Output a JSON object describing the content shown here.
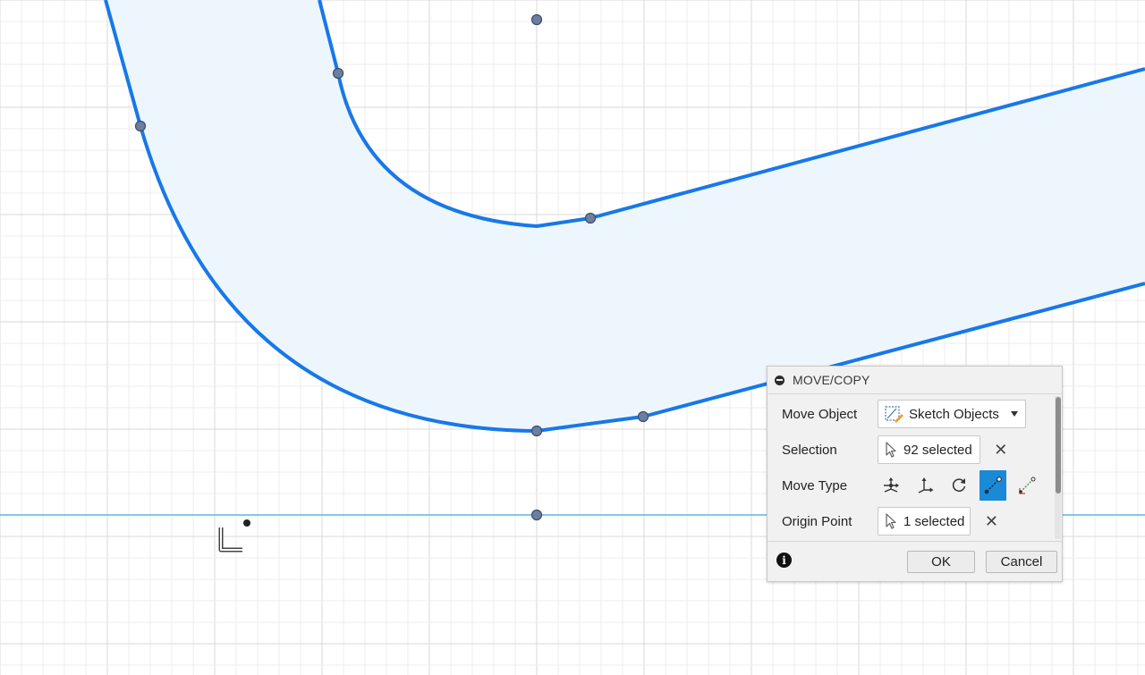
{
  "colors": {
    "curve": "#1878e8",
    "fill": "#eef6fd",
    "grid_minor": "#ececec",
    "grid_major": "#d8d8d8",
    "axis_line": "#5fb4ea",
    "point": "#6d7fa0",
    "active_tool": "#1a8ad6"
  },
  "canvas": {
    "sketch_points": 8,
    "origin_icon": "sketch-origin-icon"
  },
  "dialog": {
    "title": "MOVE/COPY",
    "move_object": {
      "label": "Move Object",
      "value": "Sketch Objects",
      "icon": "sketch-objects-icon"
    },
    "selection": {
      "label": "Selection",
      "value": "92 selected"
    },
    "move_type": {
      "label": "Move Type",
      "tools": [
        {
          "name": "free-move",
          "icon": "free-move-icon",
          "active": false
        },
        {
          "name": "translate",
          "icon": "translate-icon",
          "active": false
        },
        {
          "name": "rotate",
          "icon": "rotate-icon",
          "active": false
        },
        {
          "name": "point-to-point",
          "icon": "point-to-point-icon",
          "active": true
        },
        {
          "name": "point-to-position",
          "icon": "point-to-position-icon",
          "active": false
        }
      ]
    },
    "origin_point": {
      "label": "Origin Point",
      "value": "1 selected"
    },
    "ok_label": "OK",
    "cancel_label": "Cancel"
  }
}
